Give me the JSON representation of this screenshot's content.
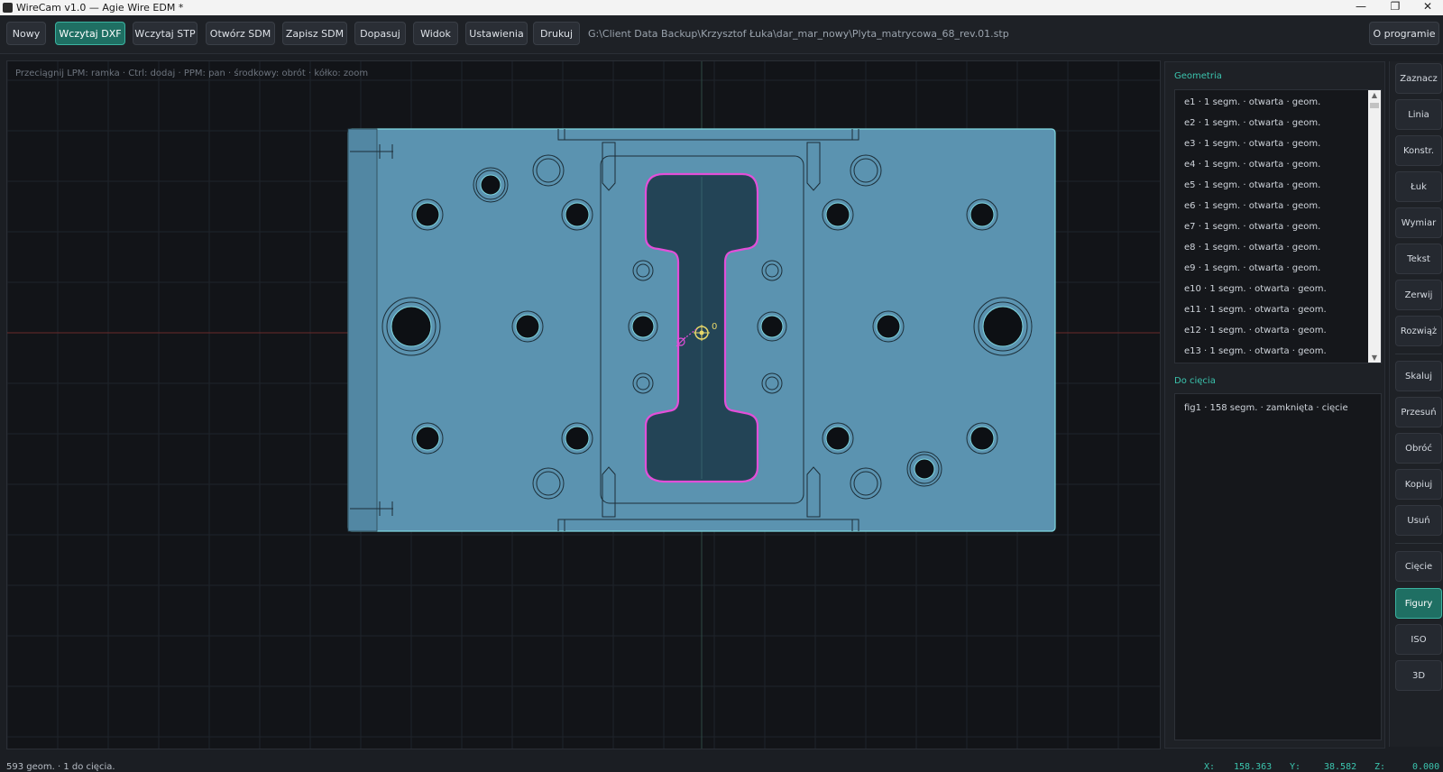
{
  "window": {
    "title": "WireCam v1.0 — Agie Wire EDM *",
    "controls": [
      "—",
      "❐",
      "✕"
    ]
  },
  "toolbar": {
    "buttons": [
      {
        "label": "Nowy",
        "active": false
      },
      {
        "label": "Wczytaj DXF",
        "active": true
      },
      {
        "label": "Wczytaj STP",
        "active": false
      },
      {
        "label": "Otwórz SDM",
        "active": false
      },
      {
        "label": "Zapisz SDM",
        "active": false
      },
      {
        "label": "Dopasuj",
        "active": false
      },
      {
        "label": "Widok",
        "active": false
      },
      {
        "label": "Ustawienia",
        "active": false
      },
      {
        "label": "Drukuj",
        "active": false
      }
    ],
    "file_path": "G:\\Client Data Backup\\Krzysztof Łuka\\dar_mar_nowy\\Plyta_matrycowa_68_rev.01.stp",
    "about_label": "O programie"
  },
  "viewport": {
    "hint": "Przeciągnij LPM: ramka  ·  Ctrl: dodaj  ·  PPM: pan  ·  środkowy: obrót  ·  kółko: zoom",
    "origin_label": "0",
    "colors": {
      "background": "#121418",
      "grid": "#1f242b",
      "axis_x": "#6b2a2a",
      "axis_y": "#2d4a44",
      "plate_fill": "#5b93b0",
      "plate_edge": "#7fd7e0",
      "cut_contour": "#e24fd9",
      "origin_marker": "#e8d86a"
    }
  },
  "panel": {
    "geometry_title": "Geometria",
    "geometry_items": [
      "e1  ·  1 segm.  ·  otwarta  ·  geom.",
      "e2  ·  1 segm.  ·  otwarta  ·  geom.",
      "e3  ·  1 segm.  ·  otwarta  ·  geom.",
      "e4  ·  1 segm.  ·  otwarta  ·  geom.",
      "e5  ·  1 segm.  ·  otwarta  ·  geom.",
      "e6  ·  1 segm.  ·  otwarta  ·  geom.",
      "e7  ·  1 segm.  ·  otwarta  ·  geom.",
      "e8  ·  1 segm.  ·  otwarta  ·  geom.",
      "e9  ·  1 segm.  ·  otwarta  ·  geom.",
      "e10  ·  1 segm.  ·  otwarta  ·  geom.",
      "e11  ·  1 segm.  ·  otwarta  ·  geom.",
      "e12  ·  1 segm.  ·  otwarta  ·  geom.",
      "e13  ·  1 segm.  ·  otwarta  ·  geom."
    ],
    "cut_title": "Do cięcia",
    "cut_items": [
      "fig1  ·  158 segm.  ·  zamknięta  ·  cięcie"
    ]
  },
  "toolbox": {
    "group1": [
      {
        "label": "Zaznacz",
        "active": false
      },
      {
        "label": "Linia",
        "active": false
      },
      {
        "label": "Konstr.",
        "active": false
      },
      {
        "label": "Łuk",
        "active": false
      },
      {
        "label": "Wymiar",
        "active": false
      },
      {
        "label": "Tekst",
        "active": false
      },
      {
        "label": "Zerwij",
        "active": false
      },
      {
        "label": "Rozwiąż",
        "active": false
      }
    ],
    "group2": [
      {
        "label": "Skaluj",
        "active": false
      },
      {
        "label": "Przesuń",
        "active": false
      },
      {
        "label": "Obróć",
        "active": false
      },
      {
        "label": "Kopiuj",
        "active": false
      },
      {
        "label": "Usuń",
        "active": false
      }
    ],
    "group3": [
      {
        "label": "Cięcie",
        "active": false
      },
      {
        "label": "Figury",
        "active": true
      },
      {
        "label": "ISO",
        "active": false
      },
      {
        "label": "3D",
        "active": false
      }
    ]
  },
  "status": {
    "summary": "593 geom. · 1 do cięcia.",
    "x_label": "X:",
    "x_value": "158.363",
    "y_label": "Y:",
    "y_value": "38.582",
    "z_label": "Z:",
    "z_value": "0.000"
  }
}
